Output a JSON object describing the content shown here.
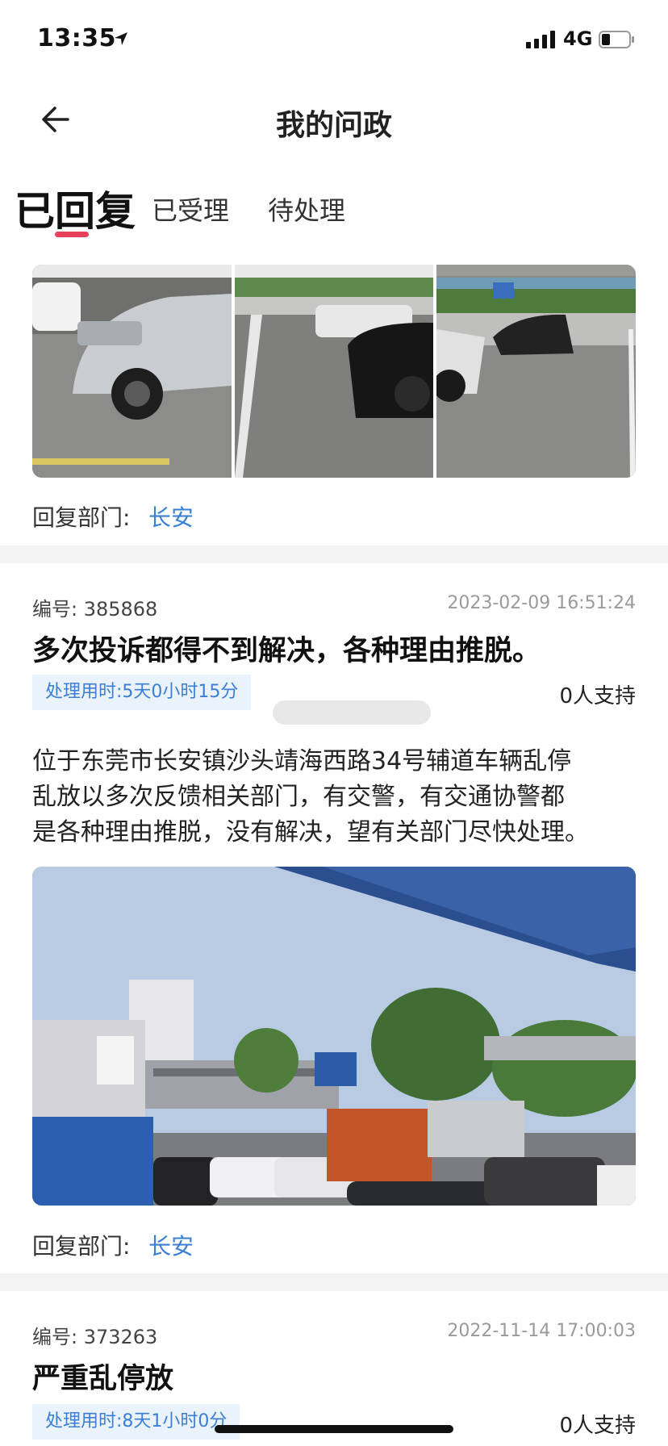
{
  "status_bar": {
    "time": "13:35",
    "network": "4G"
  },
  "header": {
    "title": "我的问政"
  },
  "tabs": [
    {
      "label": "已回复",
      "active": true
    },
    {
      "label": "已受理",
      "active": false
    },
    {
      "label": "待处理",
      "active": false
    }
  ],
  "items": [
    {
      "reply_dept_label": "回复部门:",
      "reply_dept_value": "长安"
    },
    {
      "code": "编号: 385868",
      "date": "2023-02-09 16:51:24",
      "title": "多次投诉都得不到解决，各种理由推脱。",
      "duration": "处理用时:5天0小时15分",
      "support": "0人支持",
      "body_lines": [
        "位于东莞市长安镇沙头靖海西路34号辅道车辆乱停",
        "乱放以多次反馈相关部门，有交警，有交通协警都",
        "是各种理由推脱，没有解决，望有关部门尽快处理。"
      ],
      "reply_dept_label": "回复部门:",
      "reply_dept_value": "长安"
    },
    {
      "code": "编号: 373263",
      "date": "2022-11-14 17:00:03",
      "title": "严重乱停放",
      "duration": "处理用时:8天1小时0分",
      "support": "0人支持"
    }
  ],
  "icons": {
    "back": "back-arrow-icon",
    "location": "location-arrow-icon",
    "signal": "cellular-signal-icon",
    "battery": "battery-icon"
  },
  "colors": {
    "accent": "#3a7fd4",
    "tab_indicator": "#e8405a",
    "duration_bg": "#eaf2fc"
  }
}
